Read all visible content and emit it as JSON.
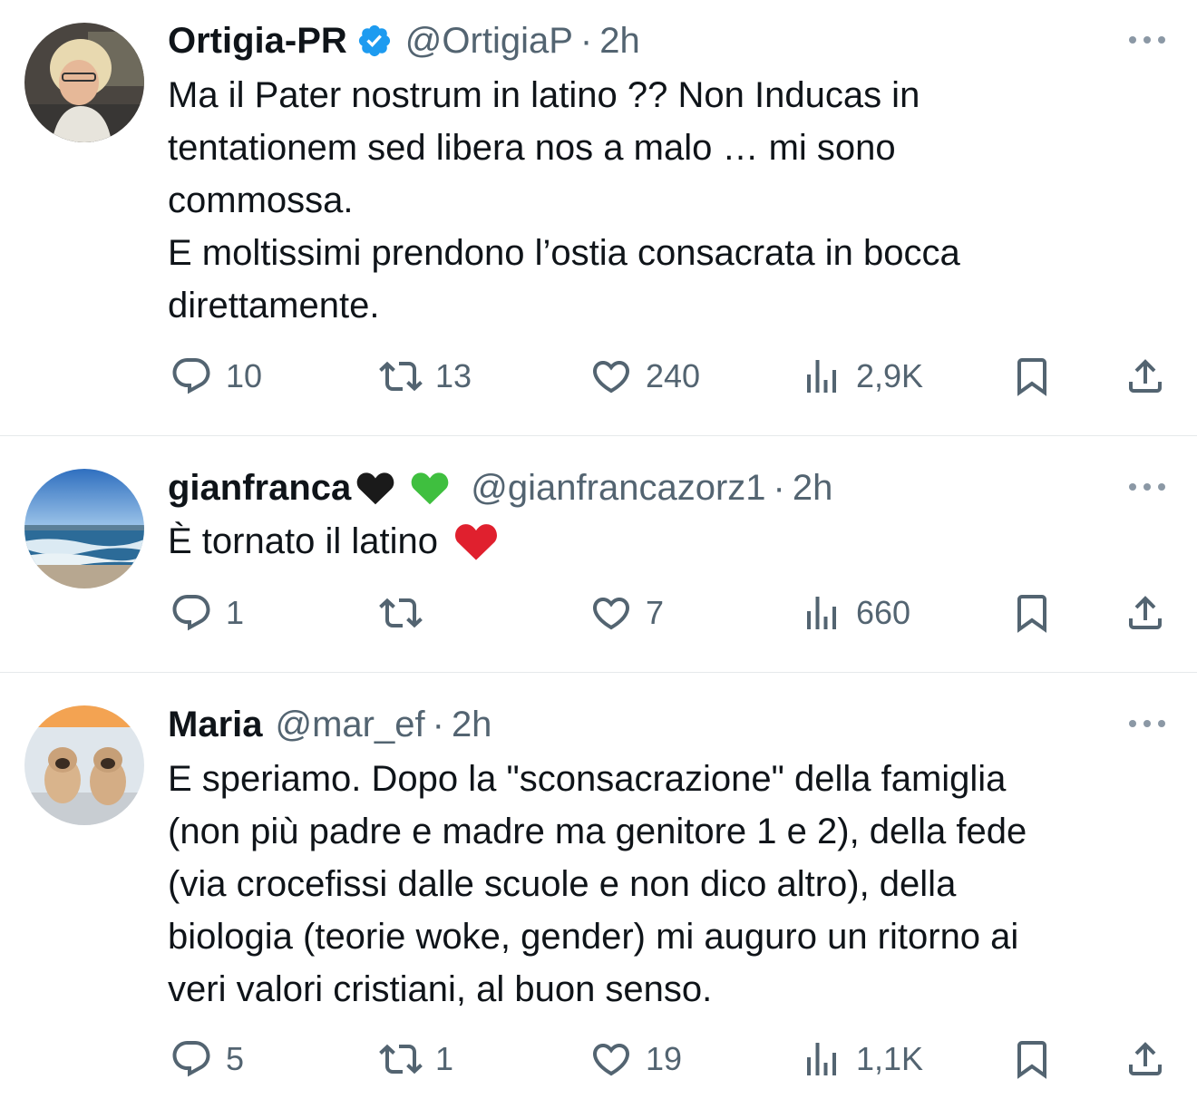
{
  "tweets": [
    {
      "name": "Ortigia-PR",
      "verified": true,
      "handle": "@OrtigiaP",
      "time": "2h",
      "text": "Ma il Pater nostrum in latino ?? Non Inducas in\ntentationem sed libera nos a malo … mi sono\ncommossa.\nE moltissimi prendono l’ostia consacrata in bocca\ndirettamente.",
      "replies": "10",
      "retweets": "13",
      "likes": "240",
      "views": "2,9K"
    },
    {
      "name": "gianfranca",
      "name_emojis": [
        "black-heart-emoji",
        "green-heart-emoji"
      ],
      "handle": "@gianfrancazorz1",
      "time": "2h",
      "text": "È tornato il latino",
      "text_emoji": "red-heart-emoji",
      "replies": "1",
      "retweets": "",
      "likes": "7",
      "views": "660"
    },
    {
      "name": "Maria",
      "handle": "@mar_ef",
      "time": "2h",
      "text": "E speriamo. Dopo la \"sconsacrazione\" della famiglia\n(non più padre e madre ma genitore 1 e 2), della fede\n(via crocefissi dalle scuole e non dico altro), della\nbiologia (teorie woke, gender) mi auguro un ritorno ai\nveri valori cristiani, al buon senso.",
      "replies": "5",
      "retweets": "1",
      "likes": "19",
      "views": "1,1K"
    }
  ],
  "dot": "·",
  "colors": {
    "text": "#0f1419",
    "secondary": "#536471",
    "verified": "#1d9bf0",
    "divider": "#e6e9eb"
  },
  "icons": [
    "reply-icon",
    "retweet-icon",
    "like-icon",
    "views-icon",
    "bookmark-icon",
    "share-icon",
    "more-icon",
    "verified-badge-icon"
  ]
}
